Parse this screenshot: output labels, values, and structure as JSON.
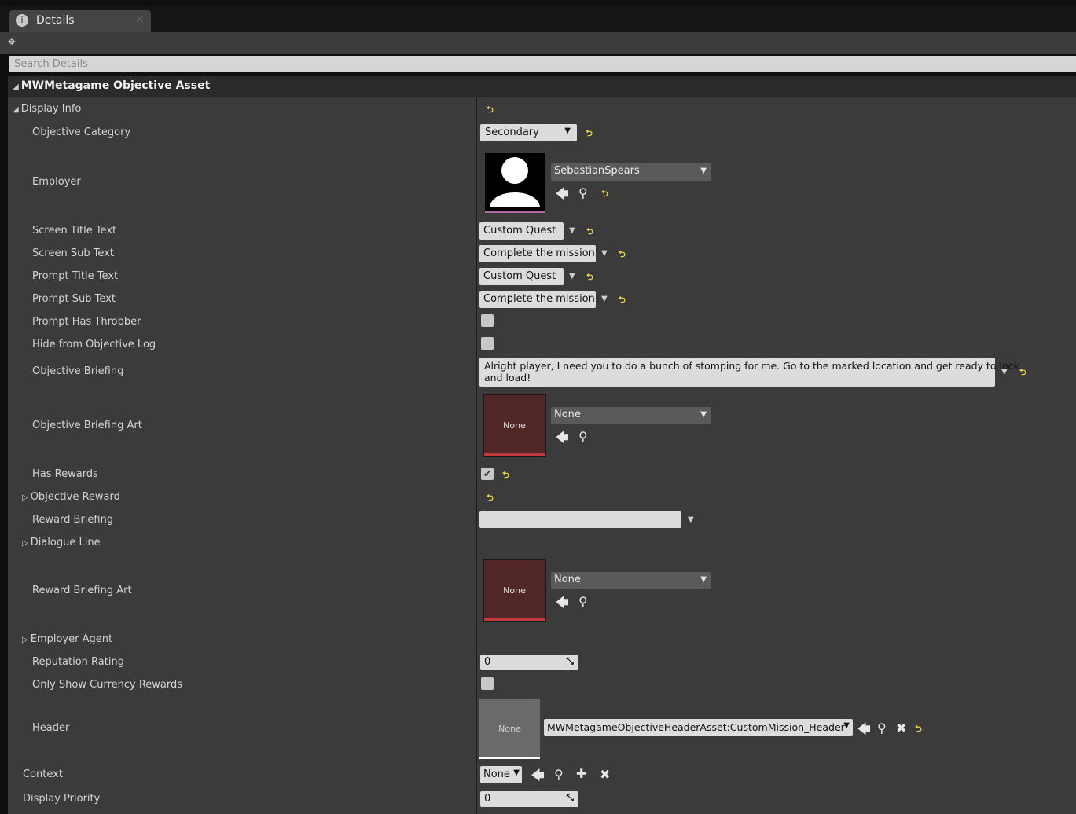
{
  "tab": {
    "title": "Details",
    "close": "×"
  },
  "search": {
    "placeholder": "Search Details"
  },
  "category": {
    "title": "MWMetagame Objective Asset"
  },
  "display_info": {
    "label": "Display Info"
  },
  "fields": {
    "objective_category": {
      "label": "Objective Category",
      "value": "Secondary"
    },
    "employer": {
      "label": "Employer",
      "asset": "SebastianSpears"
    },
    "screen_title_text": {
      "label": "Screen Title Text",
      "value": "Custom Quest"
    },
    "screen_sub_text": {
      "label": "Screen Sub Text",
      "value": "Complete the mission!"
    },
    "prompt_title_text": {
      "label": "Prompt Title Text",
      "value": "Custom Quest"
    },
    "prompt_sub_text": {
      "label": "Prompt Sub Text",
      "value": "Complete the mission!"
    },
    "prompt_has_throbber": {
      "label": "Prompt Has Throbber",
      "checked": false
    },
    "hide_from_objective_log": {
      "label": "Hide from Objective Log",
      "checked": false
    },
    "objective_briefing": {
      "label": "Objective Briefing",
      "line1": "Alright player, I need you to do a bunch of stomping for me. Go to the marked location and get ready to lock",
      "line2": "and load!"
    },
    "objective_briefing_art": {
      "label": "Objective Briefing Art",
      "thumb": "None",
      "asset": "None"
    },
    "has_rewards": {
      "label": "Has Rewards",
      "checked": true
    },
    "objective_reward": {
      "label": "Objective Reward"
    },
    "reward_briefing": {
      "label": "Reward Briefing",
      "value": ""
    },
    "dialogue_line": {
      "label": "Dialogue Line"
    },
    "reward_briefing_art": {
      "label": "Reward Briefing Art",
      "thumb": "None",
      "asset": "None"
    },
    "employer_agent": {
      "label": "Employer Agent"
    },
    "reputation_rating": {
      "label": "Reputation Rating",
      "value": "0"
    },
    "only_show_currency_rewards": {
      "label": "Only Show Currency Rewards",
      "checked": false
    },
    "header": {
      "label": "Header",
      "thumb": "None",
      "asset": "MWMetagameObjectiveHeaderAsset:CustomMission_Header"
    },
    "context": {
      "label": "Context",
      "value": "None"
    },
    "display_priority": {
      "label": "Display Priority",
      "value": "0"
    }
  },
  "colors": {
    "reset_arrow": "#f2d54a",
    "employer_bar": "#b06aa8",
    "art_bar": "#c0393b",
    "header_bar": "#ffffff"
  }
}
